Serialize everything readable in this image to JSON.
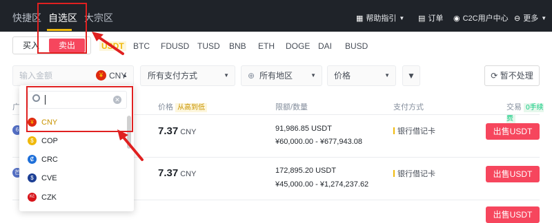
{
  "topnav": {
    "tabs": [
      "快捷区",
      "自选区",
      "大宗区"
    ],
    "help": "帮助指引",
    "orders": "订单",
    "c2c": "C2C用户中心",
    "more": "更多"
  },
  "trade": {
    "buy": "买入",
    "sell": "卖出"
  },
  "assets": [
    "USDT",
    "BTC",
    "FDUSD",
    "TUSD",
    "BNB",
    "ETH",
    "DOGE",
    "DAI",
    "BUSD"
  ],
  "filters": {
    "amount_placeholder": "输入金额",
    "currency": "CNY",
    "payment": "所有支付方式",
    "region": "所有地区",
    "price": "价格",
    "refresh": "暂不处理"
  },
  "table_header": {
    "advertiser": "广",
    "price": "价格",
    "sort": "从高到低",
    "limit": "限额/数量",
    "payment": "支付方式",
    "trade": "交易",
    "fee": "0手续费"
  },
  "rows": [
    {
      "price": "7.37",
      "unit": "CNY",
      "available": "91,986.85 USDT",
      "limit": "¥60,000.00 - ¥677,943.08",
      "payment": "银行借记卡",
      "action": "出售USDT",
      "avatar": "6"
    },
    {
      "price": "7.37",
      "unit": "CNY",
      "available": "172,895.20 USDT",
      "limit": "¥45,000.00 - ¥1,274,237.62",
      "payment": "银行借记卡",
      "action": "出售USDT",
      "avatar": "芒"
    },
    {
      "action": "出售USDT"
    }
  ],
  "dropdown": {
    "items": [
      {
        "code": "CNY",
        "symbol": "¥",
        "color": "#de2910"
      },
      {
        "code": "COP",
        "symbol": "$",
        "color": "#f0b90b"
      },
      {
        "code": "CRC",
        "symbol": "₡",
        "color": "#1e6fd9"
      },
      {
        "code": "CVE",
        "symbol": "$",
        "color": "#1c3f94"
      },
      {
        "code": "CZK",
        "symbol": "Kč",
        "color": "#d7141a"
      }
    ]
  },
  "colors": {
    "accent": "#f0b90b",
    "sell": "#f6465d",
    "annotation": "#e02020",
    "nav_bg": "#1f2329"
  }
}
